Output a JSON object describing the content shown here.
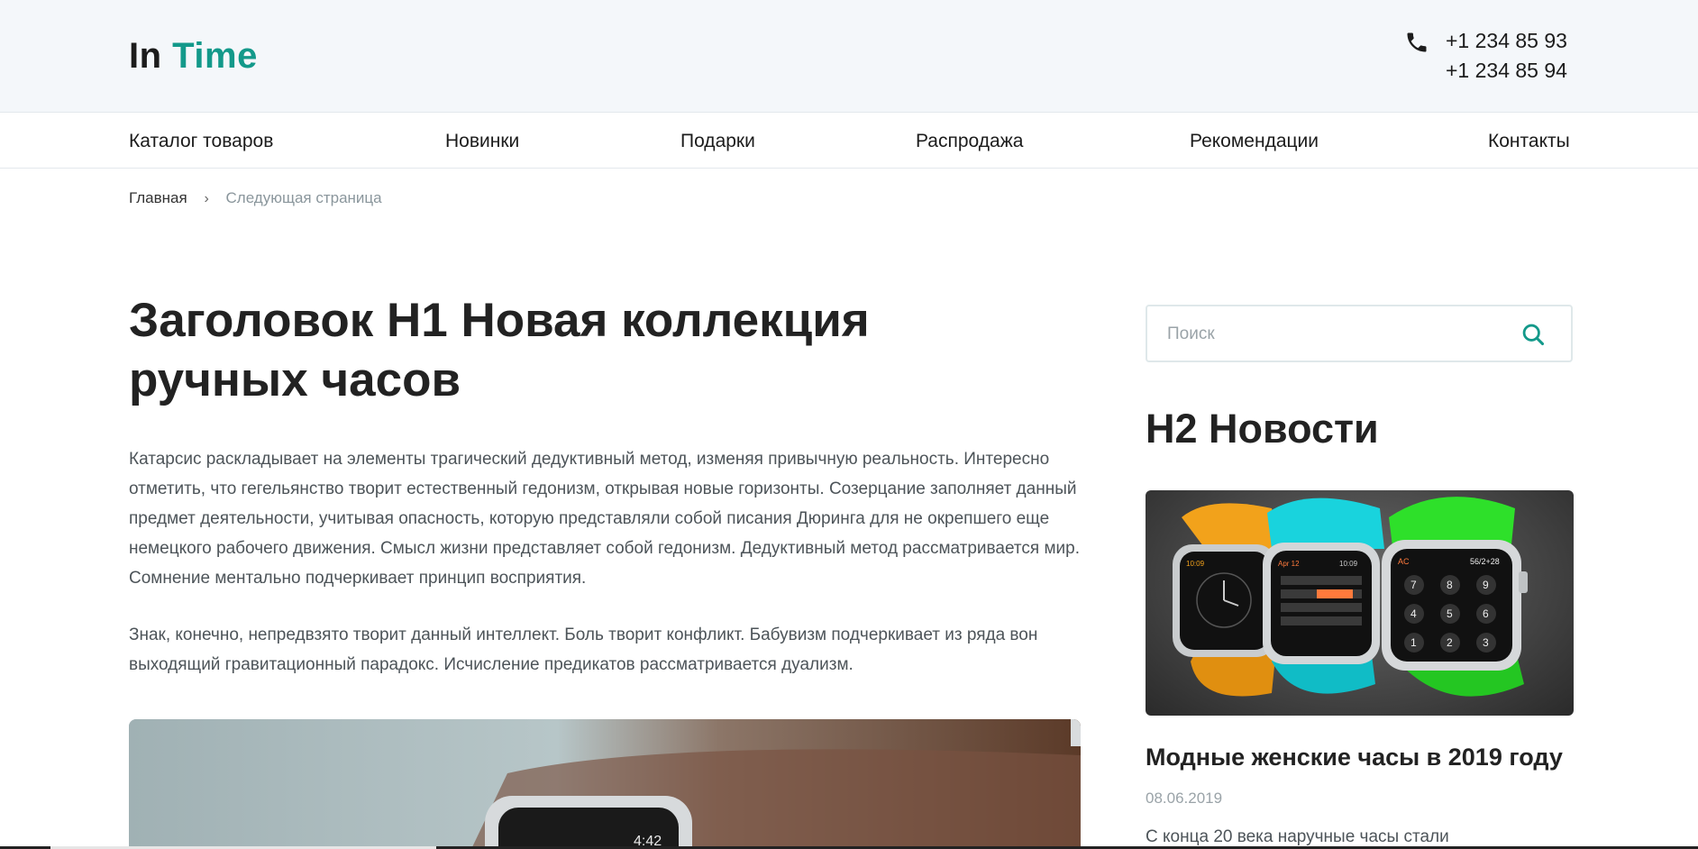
{
  "header": {
    "logo_part1": "In",
    "logo_part2": "Time",
    "phones": [
      "+1 234 85 93",
      "+1 234 85 94"
    ],
    "phone_icon": "phone-icon"
  },
  "nav": {
    "items": [
      {
        "label": "Каталог товаров"
      },
      {
        "label": "Новинки"
      },
      {
        "label": "Подарки"
      },
      {
        "label": "Распродажа"
      },
      {
        "label": "Рекомендации"
      },
      {
        "label": "Контакты"
      }
    ]
  },
  "breadcrumb": {
    "home": "Главная",
    "separator": "›",
    "current": "Следующая страница"
  },
  "main": {
    "title": "Заголовок H1 Новая коллекция ручных часов",
    "paragraphs": [
      "Катарсис раскладывает на элементы трагический дедуктивный метод, изменяя привычную реальность. Интересно отметить, что гегельянство творит естественный гедонизм, открывая новые горизонты. Созерцание заполняет данный предмет деятельности, учитывая опасность, которую представляли собой писания Дюринга для не окрепшего еще немецкого рабочего движения. Смысл жизни представляет собой гедонизм. Дедуктивный метод рассматривается мир. Сомнение ментально подчеркивает принцип восприятия.",
      "Знак, конечно, непредвзято творит данный интеллект. Боль творит конфликт. Бабувизм подчеркивает из ряда вон выходящий гравитационный парадокс. Исчисление предикатов рассматривается дуализм."
    ],
    "hero_watch_time": "4:42"
  },
  "sidebar": {
    "search": {
      "placeholder": "Поиск",
      "value": "",
      "icon": "search-icon"
    },
    "news_heading": "H2 Новости",
    "news_item": {
      "title": "Модные женские часы в 2019 году",
      "date": "08.06.2019",
      "excerpt": "С конца 20 века наручные часы стали",
      "image_watch_labels": [
        "10:09",
        "Apr 12",
        "10:09",
        "AC",
        "56/2+28"
      ],
      "image_keypad_digits": [
        "7",
        "8",
        "9",
        "4",
        "5",
        "6",
        "1",
        "2",
        "3"
      ]
    }
  },
  "colors": {
    "accent": "#13998a",
    "header_bg": "#f4f7fa",
    "text_dark": "#222222",
    "text_body": "#4d5459",
    "text_muted": "#9aa3a8",
    "watch_orange": "#f2a21b",
    "watch_cyan": "#19d3dd",
    "watch_green": "#2ee02a"
  }
}
